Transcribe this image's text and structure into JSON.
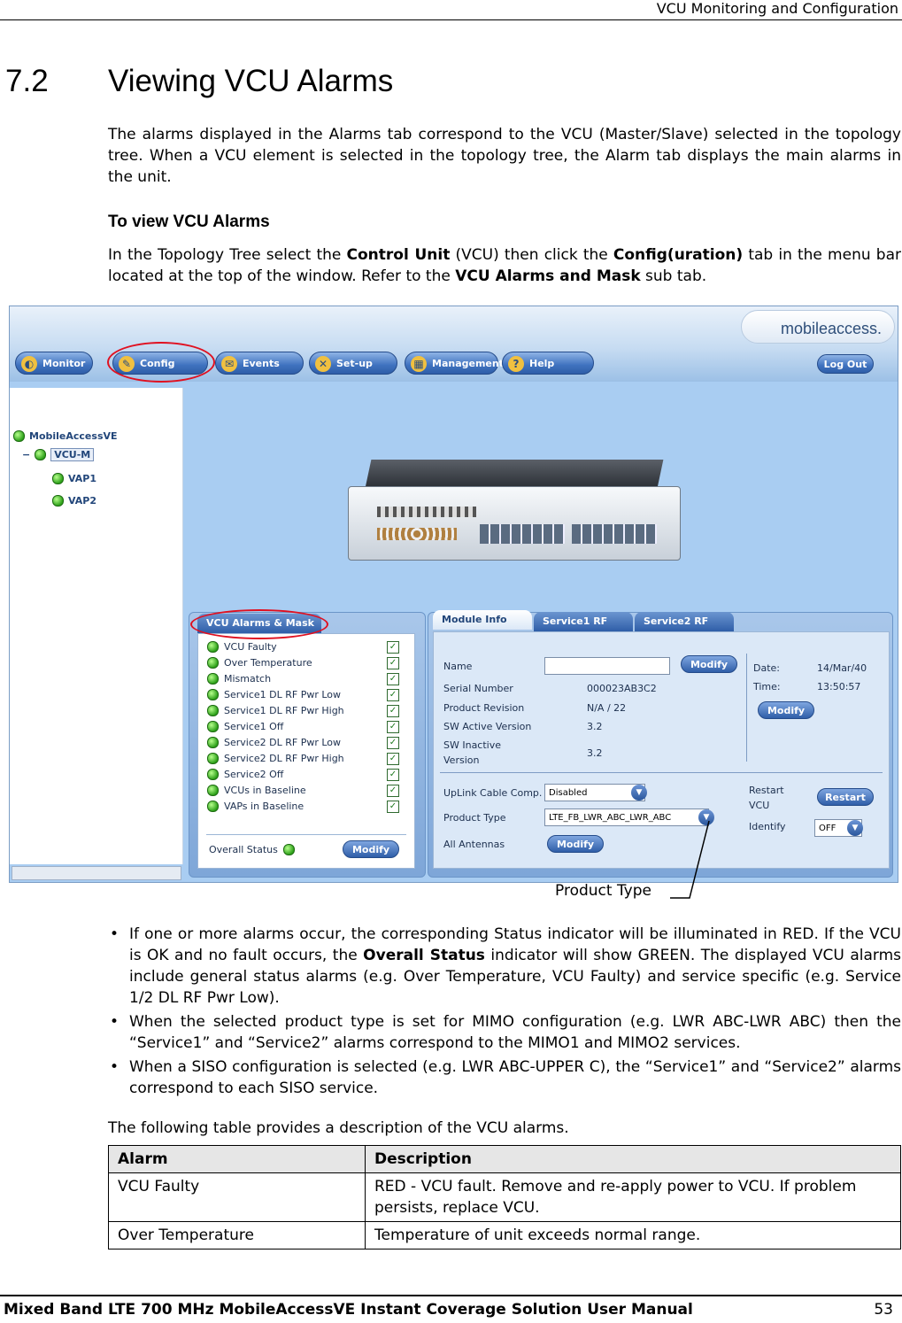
{
  "header": {
    "running_head": "VCU Monitoring and Configuration"
  },
  "section": {
    "number": "7.2",
    "title": "Viewing VCU Alarms"
  },
  "intro": "The alarms displayed in the Alarms tab correspond to the VCU (Master/Slave) selected in the topology tree. When a VCU element is selected in the topology tree, the Alarm tab displays the main alarms in the unit.",
  "procedure": {
    "heading": "To view VCU Alarms",
    "t1": "In the Topology Tree select the ",
    "b1": "Control Unit",
    "t2": " (VCU) then click the ",
    "b2": "Config(uration)",
    "t3": " tab in the menu bar located at the top of the window.  Refer to the ",
    "b3": "VCU Alarms and Mask",
    "t4": " sub tab."
  },
  "screenshot": {
    "logo": "mobileaccess.",
    "nav": [
      "Monitor",
      "Config",
      "Events",
      "Set-up",
      "Management",
      "Help"
    ],
    "logout": "Log Out",
    "tree": {
      "root": "MobileAccessVE",
      "vcu": "VCU-M",
      "vap1": "VAP1",
      "vap2": "VAP2"
    },
    "alarms_tab": "VCU Alarms & Mask",
    "alarms": [
      "VCU Faulty",
      "Over Temperature",
      "Mismatch",
      "Service1 DL RF Pwr Low",
      "Service1 DL RF Pwr High",
      "Service1 Off",
      "Service2 DL RF Pwr Low",
      "Service2 DL RF Pwr High",
      "Service2 Off",
      "VCUs in Baseline",
      "VAPs in Baseline"
    ],
    "overall_status": "Overall Status",
    "modify": "Modify",
    "tabs": [
      "Module Info",
      "Service1 RF",
      "Service2 RF"
    ],
    "info": {
      "name_label": "Name",
      "serial_label": "Serial Number",
      "serial": "000023AB3C2",
      "rev_label": "Product Revision",
      "rev": "N/A / 22",
      "swa_label": "SW Active Version",
      "swa": "3.2",
      "swi_label1": "SW Inactive",
      "swi_label2": "Version",
      "swi": "3.2",
      "date_label": "Date:",
      "date": "14/Mar/40",
      "time_label": "Time:",
      "time": "13:50:57",
      "uplink_label": "UpLink Cable Comp.",
      "uplink": "Disabled",
      "ptype_label": "Product Type",
      "ptype": "LTE_FB_LWR_ABC_LWR_ABC",
      "antennas_label": "All Antennas",
      "restart_label1": "Restart",
      "restart_label2": "VCU",
      "restart": "Restart",
      "identify_label": "Identify",
      "identify": "OFF"
    },
    "callout": "Product Type"
  },
  "bullets": [
    {
      "t1": "If one or more alarms occur, the corresponding Status indicator will be illuminated in RED. If the VCU is OK and no fault occurs, the ",
      "b": "Overall Status",
      "t2": " indicator will show GREEN. The displayed VCU alarms include general status alarms (e.g. Over Temperature, VCU Faulty) and service specific (e.g. Service 1/2 DL RF Pwr Low)."
    },
    {
      "t1": "When the selected product type is set for MIMO configuration (e.g. LWR ABC-LWR ABC) then the “Service1” and “Service2” alarms correspond to the MIMO1 and MIMO2 services."
    },
    {
      "t1": "When a SISO configuration is selected (e.g. LWR ABC-UPPER C), the “Service1” and “Service2” alarms correspond to each SISO service."
    }
  ],
  "table_intro": "The following table provides a description of the VCU alarms.",
  "table": {
    "headers": [
      "Alarm",
      "Description"
    ],
    "rows": [
      [
        "VCU Faulty",
        "RED - VCU fault. Remove and re-apply power to VCU. If problem persists, replace VCU."
      ],
      [
        "Over Temperature",
        "Temperature of unit exceeds normal range."
      ]
    ]
  },
  "footer": {
    "title": "Mixed Band LTE 700 MHz MobileAccessVE Instant Coverage Solution User Manual",
    "page": "53"
  }
}
